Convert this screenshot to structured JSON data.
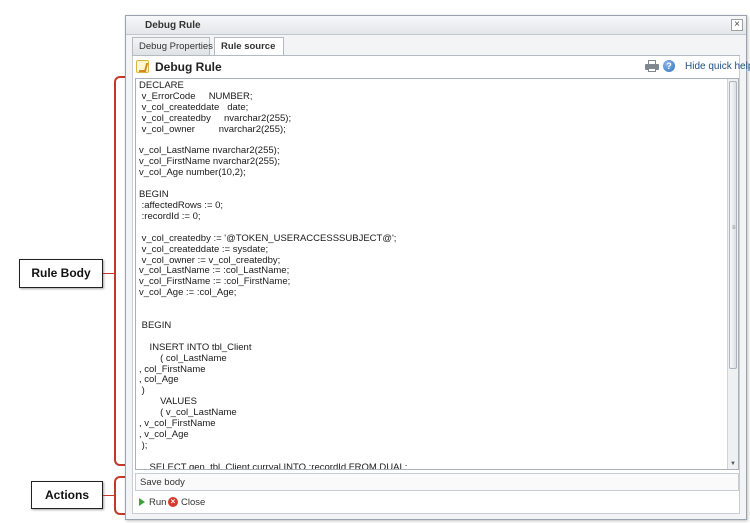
{
  "dialog": {
    "title": "Debug Rule",
    "close_glyph": "×",
    "tabs": [
      {
        "label": "Debug Properties",
        "active": false
      },
      {
        "label": "Rule source",
        "active": true
      }
    ],
    "panel_title": "Debug Rule",
    "hide_help_label": "Hide quick help",
    "icons": {
      "title": "rule-icon",
      "print": "printer-icon",
      "help": "help-icon"
    },
    "code_lines": [
      "DECLARE",
      " v_ErrorCode     NUMBER;",
      " v_col_createddate   date;",
      " v_col_createdby     nvarchar2(255);",
      " v_col_owner         nvarchar2(255);",
      "",
      "v_col_LastName nvarchar2(255);",
      "v_col_FirstName nvarchar2(255);",
      "v_col_Age number(10,2);",
      "",
      "BEGIN",
      " :affectedRows := 0;",
      " :recordId := 0;",
      "",
      " v_col_createdby := '@TOKEN_USERACCESSSUBJECT@';",
      " v_col_createddate := sysdate;",
      " v_col_owner := v_col_createdby;",
      "v_col_LastName := :col_LastName;",
      "v_col_FirstName := :col_FirstName;",
      "v_col_Age := :col_Age;",
      "",
      "",
      " BEGIN",
      "",
      "    INSERT INTO tbl_Client",
      "        ( col_LastName",
      ", col_FirstName",
      ", col_Age",
      " )",
      "        VALUES",
      "        ( v_col_LastName",
      ", v_col_FirstName",
      ", v_col_Age",
      " );",
      "",
      "    SELECT gen_tbl_Client.currval INTO :recordId FROM DUAL;"
    ],
    "save_body_label": "Save body",
    "actions": {
      "run_label": "Run",
      "close_label": "Close"
    }
  },
  "annotations": {
    "rule_body_label": "Rule Body",
    "actions_label": "Actions",
    "accent_color": "#c0392b"
  }
}
